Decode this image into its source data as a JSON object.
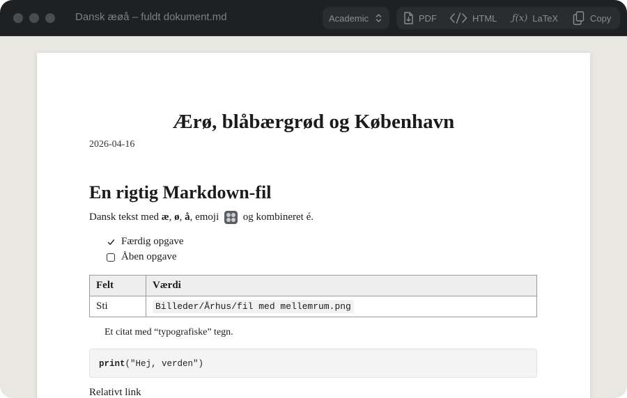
{
  "window": {
    "title": "Dansk æøå – fuldt dokument.md"
  },
  "toolbar": {
    "theme": "Academic",
    "pdf_label": "PDF",
    "html_label": "HTML",
    "latex_label": "LaTeX",
    "latex_icon": "ƒ(x)",
    "copy_label": "Copy"
  },
  "document": {
    "title": "Ærø, blåbærgrød og København",
    "date": "2026-04-16",
    "heading": "En rigtig Markdown-fil",
    "paragraph": {
      "prefix": "Dansk tekst med ",
      "ae": "æ",
      "sep1": ", ",
      "oe": "ø",
      "sep2": ", ",
      "aa": "å",
      "mid": ", emoji ",
      "suffix": " og kombineret é."
    },
    "tasks": [
      {
        "label": "Færdig opgave",
        "checked": true
      },
      {
        "label": "Åben opgave",
        "checked": false
      }
    ],
    "table": {
      "headers": [
        "Felt",
        "Værdi"
      ],
      "rows": [
        {
          "key": "Sti",
          "value": "Billeder/Århus/fil med mellemrum.png"
        }
      ]
    },
    "quote": "Et citat med “typografiske” tegn.",
    "code": {
      "keyword": "print",
      "args": "(\"Hej, verden\")"
    },
    "relative_link": "Relativt link"
  },
  "colors": {
    "titlebar": "#1e2022",
    "background": "#e9e7e1",
    "page": "#ffffff"
  }
}
